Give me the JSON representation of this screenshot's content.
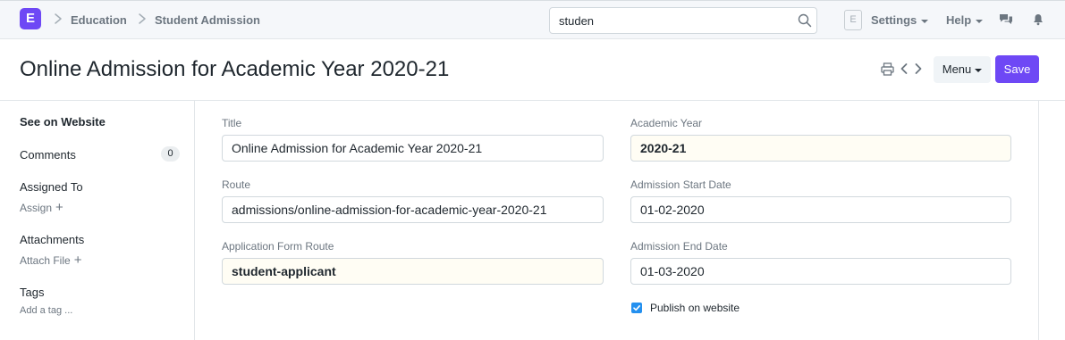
{
  "navbar": {
    "logo_letter": "E",
    "breadcrumbs": [
      "Education",
      "Student Admission"
    ],
    "search_value": "studen",
    "avatar_letter": "E",
    "settings_label": "Settings",
    "help_label": "Help"
  },
  "page": {
    "title": "Online Admission for Academic Year 2020-21",
    "menu_label": "Menu",
    "save_label": "Save"
  },
  "sidebar": {
    "see_on_website": "See on Website",
    "comments_label": "Comments",
    "comments_count": "0",
    "assigned_to_label": "Assigned To",
    "assign_action": "Assign",
    "attachments_label": "Attachments",
    "attach_action": "Attach File",
    "tags_label": "Tags",
    "add_tag_action": "Add a tag ..."
  },
  "form": {
    "title_label": "Title",
    "title_value": "Online Admission for Academic Year 2020-21",
    "route_label": "Route",
    "route_value": "admissions/online-admission-for-academic-year-2020-21",
    "app_form_route_label": "Application Form Route",
    "app_form_route_value": "student-applicant",
    "academic_year_label": "Academic Year",
    "academic_year_value": "2020-21",
    "start_date_label": "Admission Start Date",
    "start_date_value": "01-02-2020",
    "end_date_label": "Admission End Date",
    "end_date_value": "01-03-2020",
    "publish_label": "Publish on website",
    "publish_checked": true
  },
  "colors": {
    "brand": "#6e48f5",
    "checkbox": "#2490ef",
    "mandatory_field_bg": "#fffdf4"
  }
}
